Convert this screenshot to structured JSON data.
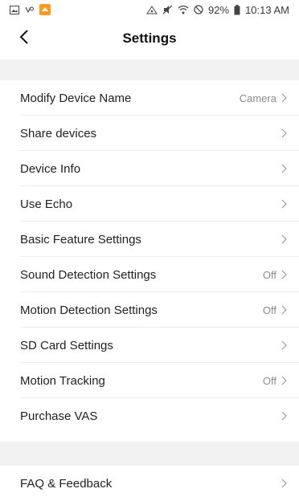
{
  "status_bar": {
    "battery_percent": "92%",
    "time": "10:13 AM",
    "left_icons": [
      "gallery-icon",
      "vibrate-icon",
      "app-notification-icon"
    ],
    "right_icons": [
      "hotspot-icon",
      "mute-icon",
      "wifi-icon",
      "dnd-icon",
      "battery-icon"
    ]
  },
  "header": {
    "title": "Settings",
    "back_icon": "chevron-left-icon"
  },
  "settings": [
    {
      "label": "Modify Device Name",
      "value": "Camera"
    },
    {
      "label": "Share devices",
      "value": ""
    },
    {
      "label": "Device Info",
      "value": ""
    },
    {
      "label": "Use Echo",
      "value": ""
    },
    {
      "label": "Basic Feature Settings",
      "value": ""
    },
    {
      "label": "Sound Detection Settings",
      "value": "Off"
    },
    {
      "label": "Motion Detection Settings",
      "value": "Off"
    },
    {
      "label": "SD Card Settings",
      "value": ""
    },
    {
      "label": "Motion Tracking",
      "value": "Off"
    },
    {
      "label": "Purchase VAS",
      "value": ""
    }
  ],
  "settings2": [
    {
      "label": "FAQ & Feedback",
      "value": ""
    }
  ],
  "colors": {
    "background": "#ffffff",
    "section_gap": "#f2f2f2",
    "divider": "#ececec",
    "chevron": "#9a9a9a"
  }
}
